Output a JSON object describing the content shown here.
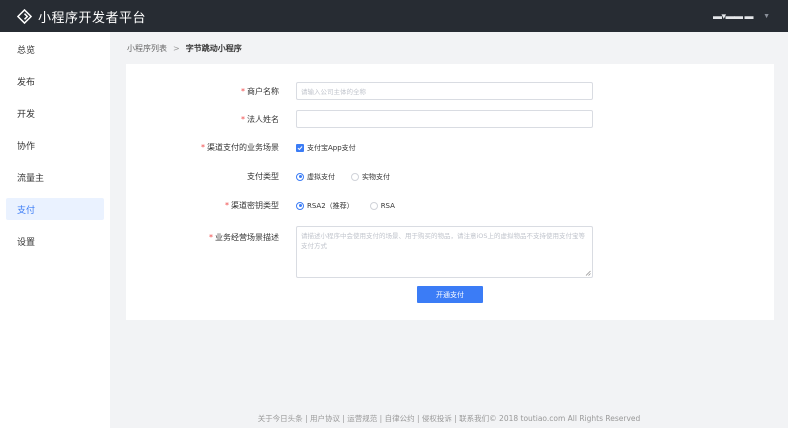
{
  "header": {
    "title": "小程序开发者平台",
    "user_name": "▬▾▬▬ ▬",
    "logo_icon": "diamond-logo-icon"
  },
  "sidebar": {
    "items": [
      {
        "label": "总览",
        "active": false
      },
      {
        "label": "发布",
        "active": false
      },
      {
        "label": "开发",
        "active": false
      },
      {
        "label": "协作",
        "active": false
      },
      {
        "label": "流量主",
        "active": false
      },
      {
        "label": "支付",
        "active": true
      },
      {
        "label": "设置",
        "active": false
      }
    ]
  },
  "breadcrumb": {
    "parent": "小程序列表",
    "separator": ">",
    "current": "字节跳动小程序"
  },
  "form": {
    "merchant_name": {
      "label": "商户名称",
      "placeholder": "请输入公司主体的全称",
      "required": true
    },
    "legal_name": {
      "label": "法人姓名",
      "value": "",
      "required": true
    },
    "business_scene": {
      "label": "渠道支付的业务场景",
      "required": true,
      "option": "支付宝App支付",
      "checked": true
    },
    "pay_type": {
      "label": "支付类型",
      "required": false,
      "options": [
        "虚拟支付",
        "实物支付"
      ],
      "selected": 0
    },
    "key_type": {
      "label": "渠道密钥类型",
      "required": true,
      "options": [
        "RSA2（推荐）",
        "RSA"
      ],
      "selected": 0
    },
    "description": {
      "label": "业务经营场景描述",
      "required": true,
      "placeholder": "请描述小程序中会使用支付的场景、用于购买的物品，请注意iOS上的虚拟物品不支持使用支付宝等支付方式"
    },
    "submit_label": "开通支付"
  },
  "footer": {
    "text": "关于今日头条 | 用户协议 | 运营规范 | 自律公约 | 侵权投诉 | 联系我们© 2018 toutiao.com All Rights Reserved"
  },
  "colors": {
    "accent": "#3b7cf6",
    "topbar": "#272c33",
    "required": "#f04a4a"
  }
}
